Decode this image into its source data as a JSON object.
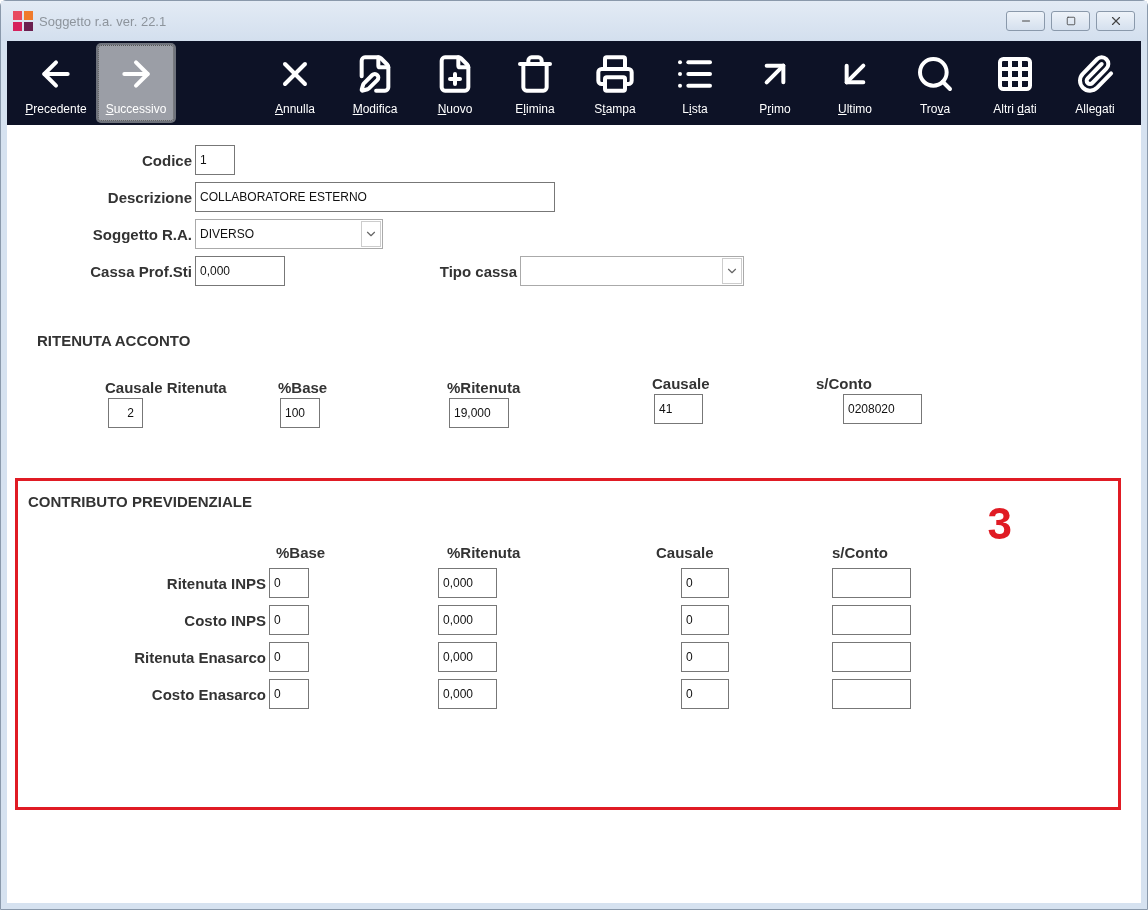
{
  "window": {
    "title": "Soggetto r.a.  ver. 22.1"
  },
  "toolbar": [
    {
      "kind": "back",
      "key": "P",
      "after": "recedente",
      "selected": false
    },
    {
      "kind": "forward",
      "key": "S",
      "after": "uccessivo",
      "selected": true
    },
    {
      "kind": "cancel",
      "key": "A",
      "after": "nnulla",
      "selected": false
    },
    {
      "kind": "edit",
      "key": "M",
      "after": "odifica",
      "selected": false
    },
    {
      "kind": "new",
      "key": "N",
      "after": "uovo",
      "selected": false
    },
    {
      "kind": "delete",
      "before": "E",
      "key": "l",
      "after": "imina",
      "selected": false
    },
    {
      "kind": "print",
      "before": "S",
      "key": "t",
      "after": "ampa",
      "selected": false
    },
    {
      "kind": "list",
      "before": "L",
      "key": "i",
      "after": "sta",
      "selected": false
    },
    {
      "kind": "first",
      "before": "P",
      "key": "r",
      "after": "imo",
      "selected": false
    },
    {
      "kind": "last",
      "key": "U",
      "after": "ltimo",
      "selected": false
    },
    {
      "kind": "find",
      "before": "Tro",
      "key": "v",
      "after": "a",
      "selected": false
    },
    {
      "kind": "grid",
      "before": "Altri ",
      "key": "d",
      "after": "ati",
      "selected": false
    },
    {
      "kind": "attach",
      "before": "Allegati",
      "selected": false
    }
  ],
  "form": [
    [
      {
        "kind": "text",
        "label": "Codice",
        "value": "1"
      }
    ],
    [
      {
        "kind": "text",
        "label": "Descrizione",
        "value": "COLLABORATORE ESTERNO"
      }
    ],
    [
      {
        "kind": "select",
        "label": "Soggetto R.A.",
        "value": "DIVERSO"
      }
    ],
    [
      {
        "kind": "text",
        "label": "Cassa Prof.Sti",
        "value": "0,000"
      },
      {
        "kind": "select",
        "label": "Tipo cassa"
      }
    ]
  ],
  "ritenuta": {
    "title": "RITENUTA ACCONTO",
    "columns": [
      {
        "header": "Causale Ritenuta",
        "value": "2"
      },
      {
        "header": "%Base",
        "value": "100"
      },
      {
        "header": "%Ritenuta",
        "value": "19,000"
      },
      {
        "header": "Causale",
        "value": "41"
      },
      {
        "header": "s/Conto",
        "value": "0208020"
      }
    ]
  },
  "contributo": {
    "title": "CONTRIBUTO PREVIDENZIALE",
    "annotation": "3",
    "columns": [
      "%Base",
      "%Ritenuta",
      "Causale",
      "s/Conto"
    ],
    "rows": [
      {
        "label": "Ritenuta INPS",
        "base": "0",
        "ritenuta": "0,000",
        "causale": "0"
      },
      {
        "label": "Costo INPS",
        "base": "0",
        "ritenuta": "0,000",
        "causale": "0"
      },
      {
        "label": "Ritenuta Enasarco",
        "base": "0",
        "ritenuta": "0,000",
        "causale": "0"
      },
      {
        "label": "Costo Enasarco",
        "base": "0",
        "ritenuta": "0,000",
        "causale": "0"
      }
    ]
  }
}
